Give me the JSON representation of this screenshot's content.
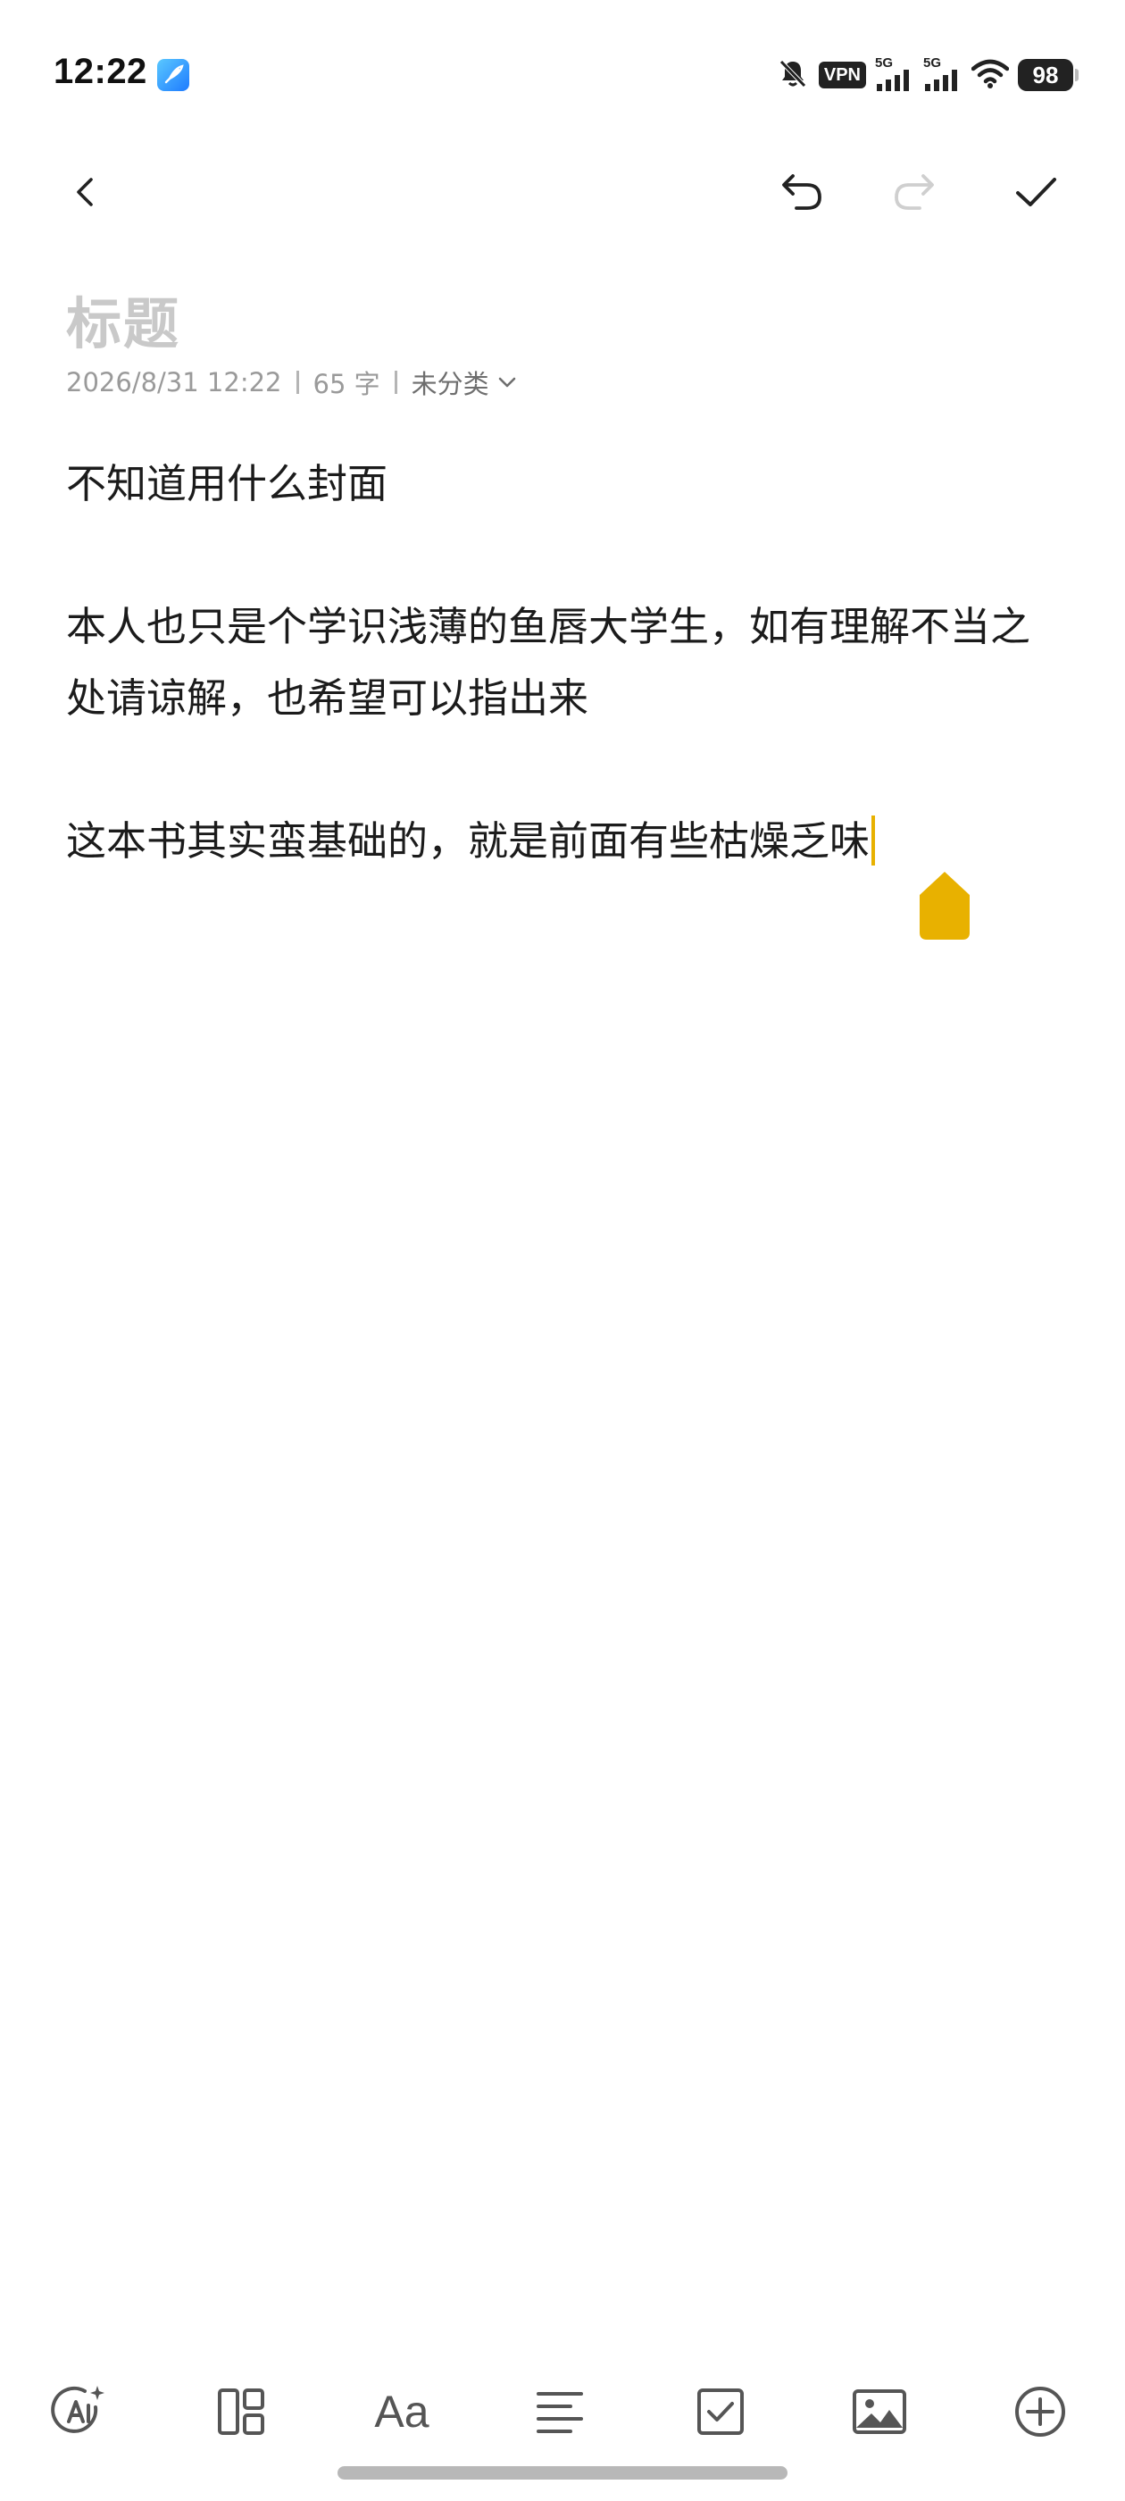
{
  "status_bar": {
    "time": "12:22",
    "vpn": "VPN",
    "sim1_tag": "5G",
    "sim2_tag": "5G",
    "battery": "98"
  },
  "note": {
    "title_placeholder": "标题",
    "date": "2026/8/31 12:22",
    "word_count": "65 字",
    "category": "未分类",
    "paragraphs": [
      "不知道用什么封面",
      "本人也只是个学识浅薄的鱼唇大学生，如有理解不当之处请谅解，也希望可以指出来",
      "这本书其实蛮基础的，就是前面有些枯燥乏味"
    ]
  },
  "icons": {
    "back": "chevron-left-icon",
    "undo": "undo-icon",
    "redo": "redo-icon",
    "done": "checkmark-icon",
    "toolbar": [
      "ai-icon",
      "layout-icon",
      "font-icon",
      "align-icon",
      "checkbox-icon",
      "image-icon",
      "add-icon"
    ]
  },
  "toolbar": {
    "font_label": "Aa"
  },
  "colors": {
    "cursor": "#e8b100",
    "title_placeholder": "#c9c9c9",
    "meta_text": "#9a9a9a",
    "disabled_icon": "#cfcfcf"
  }
}
